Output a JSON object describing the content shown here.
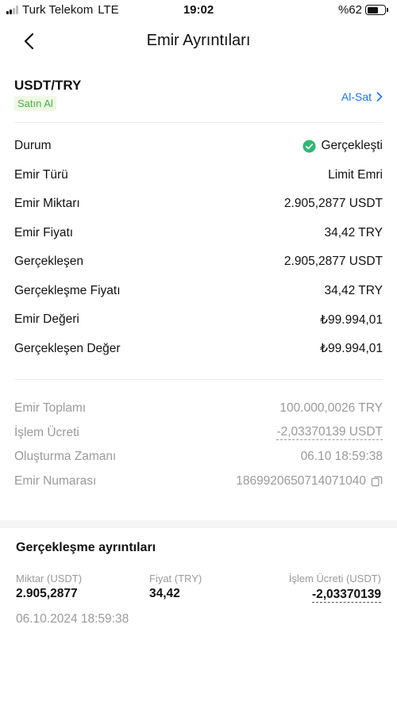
{
  "status_bar": {
    "carrier": "Turk Telekom",
    "network": "LTE",
    "time": "19:02",
    "battery": "%62",
    "battery_level": 0.62
  },
  "nav": {
    "back_icon": "chevron-left-icon",
    "title": "Emir Ayrıntıları"
  },
  "pair": {
    "symbol": "USDT/TRY",
    "side": "Satın Al",
    "trade_link": "Al-Sat",
    "accent": "#1a73e8",
    "buy_color": "#4caf50"
  },
  "details": [
    {
      "label": "Durum",
      "value": "Gerçekleşti",
      "icon": "check-circle-icon"
    },
    {
      "label": "Emir Türü",
      "value": "Limit Emri"
    },
    {
      "label": "Emir Miktarı",
      "value": "2.905,2877 USDT"
    },
    {
      "label": "Emir Fiyatı",
      "value": "34,42 TRY"
    },
    {
      "label": "Gerçekleşen",
      "value": "2.905,2877 USDT"
    },
    {
      "label": "Gerçekleşme Fiyatı",
      "value": "34,42 TRY"
    },
    {
      "label": "Emir Değeri",
      "value": "₺99.994,01"
    },
    {
      "label": "Gerçekleşen Değer",
      "value": "₺99.994,01"
    }
  ],
  "summary": [
    {
      "label": "Emir Toplamı",
      "value": "100.000,0026 TRY"
    },
    {
      "label": "İşlem Ücreti",
      "value": "-2,03370139 USDT"
    },
    {
      "label": "Oluşturma Zamanı",
      "value": "06.10 18:59:38"
    },
    {
      "label": "Emir Numarası",
      "value": "1869920650714071040",
      "icon": "copy-icon"
    }
  ],
  "fills": {
    "title": "Gerçekleşme ayrıntıları",
    "headers": [
      "Miktar (USDT)",
      "Fiyat  (TRY)",
      "İşlem Ücreti (USDT)"
    ],
    "values": [
      "2.905,2877",
      "34,42",
      "-2,03370139"
    ],
    "date": "06.10.2024 18:59:38"
  }
}
